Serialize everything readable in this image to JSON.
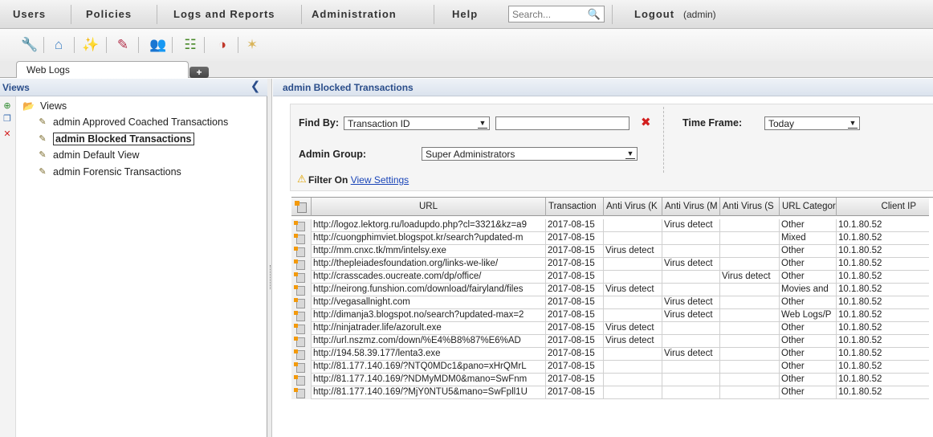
{
  "menu": {
    "users": "Users",
    "policies": "Policies",
    "logs_reports": "Logs and Reports",
    "administration": "Administration",
    "help": "Help",
    "search_placeholder": "Search...",
    "logout": "Logout",
    "user": "(admin)"
  },
  "toolbar_icons": [
    "wrench-icon",
    "home-icon",
    "wand-icon",
    "policy-edit-icon",
    "user-search-icon",
    "network-icon",
    "gauge-icon",
    "star-icon"
  ],
  "tabs": {
    "active_label": "Web Logs",
    "add_label": "+"
  },
  "views_panel": {
    "title": "Views",
    "root_label": "Views",
    "items": [
      {
        "label": "admin Approved Coached Transactions",
        "selected": false
      },
      {
        "label": "admin Blocked Transactions",
        "selected": true
      },
      {
        "label": "admin Default View",
        "selected": false
      },
      {
        "label": "admin Forensic Transactions",
        "selected": false
      }
    ]
  },
  "main": {
    "title": "admin Blocked Transactions",
    "filter": {
      "find_by_label": "Find By:",
      "find_by_value": "Transaction ID",
      "find_text": "",
      "time_frame_label": "Time Frame:",
      "time_frame_value": "Today",
      "admin_group_label": "Admin Group:",
      "admin_group_value": "Super Administrators",
      "filter_on_label": "Filter On",
      "view_settings_link": "View Settings"
    },
    "table": {
      "columns": [
        "URL",
        "Transaction",
        "Anti Virus (K",
        "Anti Virus (M",
        "Anti Virus (S",
        "URL Categor",
        "Client IP"
      ],
      "rows": [
        [
          "http://logoz.lektorg.ru/loadupdo.php?cl=3321&kz=a9",
          "2017-08-15",
          "",
          "Virus detect",
          "",
          "Other",
          "10.1.80.52"
        ],
        [
          "http://cuongphimviet.blogspot.kr/search?updated-m",
          "2017-08-15",
          "",
          "",
          "",
          "Mixed",
          "10.1.80.52"
        ],
        [
          "http://mm.cnxc.tk/mm/intelsy.exe",
          "2017-08-15",
          "Virus detect",
          "",
          "",
          "Other",
          "10.1.80.52"
        ],
        [
          "http://thepleiadesfoundation.org/links-we-like/",
          "2017-08-15",
          "",
          "Virus detect",
          "",
          "Other",
          "10.1.80.52"
        ],
        [
          "http://crasscades.oucreate.com/dp/office/",
          "2017-08-15",
          "",
          "",
          "Virus detect",
          "Other",
          "10.1.80.52"
        ],
        [
          "http://neirong.funshion.com/download/fairyland/files",
          "2017-08-15",
          "Virus detect",
          "",
          "",
          "Movies and",
          "10.1.80.52"
        ],
        [
          "http://vegasallnight.com",
          "2017-08-15",
          "",
          "Virus detect",
          "",
          "Other",
          "10.1.80.52"
        ],
        [
          "http://dimanja3.blogspot.no/search?updated-max=2",
          "2017-08-15",
          "",
          "Virus detect",
          "",
          "Web Logs/P",
          "10.1.80.52"
        ],
        [
          "http://ninjatrader.life/azorult.exe",
          "2017-08-15",
          "Virus detect",
          "",
          "",
          "Other",
          "10.1.80.52"
        ],
        [
          "http://url.nszmz.com/down/%E4%B8%87%E6%AD",
          "2017-08-15",
          "Virus detect",
          "",
          "",
          "Other",
          "10.1.80.52"
        ],
        [
          "http://194.58.39.177/lenta3.exe",
          "2017-08-15",
          "",
          "Virus detect",
          "",
          "Other",
          "10.1.80.52"
        ],
        [
          "http://81.177.140.169/?NTQ0MDc1&pano=xHrQMrL",
          "2017-08-15",
          "",
          "",
          "",
          "Other",
          "10.1.80.52"
        ],
        [
          "http://81.177.140.169/?NDMyMDM0&mano=SwFnm",
          "2017-08-15",
          "",
          "",
          "",
          "Other",
          "10.1.80.52"
        ],
        [
          "http://81.177.140.169/?MjY0NTU5&mano=SwFpll1U",
          "2017-08-15",
          "",
          "",
          "",
          "Other",
          "10.1.80.52"
        ]
      ]
    }
  },
  "colors": {
    "header_text": "#2a4d8a",
    "link": "#1a45b8",
    "clear_x": "#d21f1f"
  }
}
